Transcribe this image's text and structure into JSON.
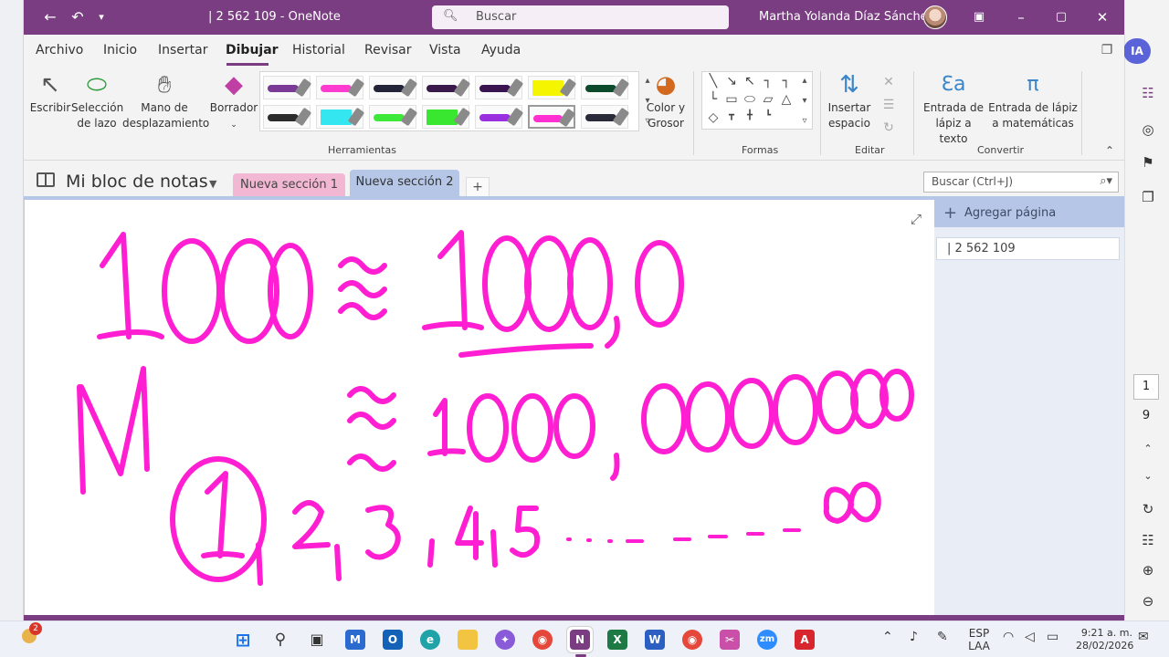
{
  "window": {
    "title": "| 2 562 109  -  OneNote",
    "search_placeholder": "Buscar",
    "user_name": "Martha Yolanda Díaz Sánchez"
  },
  "menu": {
    "items": [
      "Archivo",
      "Inicio",
      "Insertar",
      "Dibujar",
      "Historial",
      "Revisar",
      "Vista",
      "Ayuda"
    ],
    "active": "Dibujar"
  },
  "ribbon": {
    "escribir": "Escribir",
    "seleccion1": "Selección",
    "seleccion2": "de lazo",
    "mano1": "Mano de",
    "mano2": "desplazamiento",
    "borrador": "Borrador",
    "herramientas": "Herramientas",
    "color1": "Color y",
    "color2": "Grosor",
    "formas": "Formas",
    "insertar1": "Insertar",
    "insertar2": "espacio",
    "editar": "Editar",
    "entrada_texto1": "Entrada de",
    "entrada_texto2": "lápiz a texto",
    "entrada_mat1": "Entrada de lápiz",
    "entrada_mat2": "a matemáticas",
    "convertir": "Convertir",
    "pens": [
      {
        "color": "#7a3a96",
        "type": "pen"
      },
      {
        "color": "#ff3ccf",
        "type": "pen"
      },
      {
        "color": "#23233a",
        "type": "pen"
      },
      {
        "color": "#3a1a4a",
        "type": "pen"
      },
      {
        "color": "#3a1450",
        "type": "pen"
      },
      {
        "color": "#f5f500",
        "type": "highlighter"
      },
      {
        "color": "#0d4a2b",
        "type": "pen"
      },
      {
        "color": "#2b2b2b",
        "type": "pen"
      },
      {
        "color": "#33e6f0",
        "type": "highlighter"
      },
      {
        "color": "#3de838",
        "type": "pen"
      },
      {
        "color": "#39e630",
        "type": "highlighter"
      },
      {
        "color": "#9a2fe0",
        "type": "pen"
      },
      {
        "color": "#ff2fd2",
        "type": "pen"
      },
      {
        "color": "#2a2a3a",
        "type": "pen"
      }
    ],
    "selected_pen_index": 12
  },
  "notebook": {
    "name": "Mi bloc de notas",
    "sections": [
      "Nueva sección 1",
      "Nueva sección 2"
    ],
    "add_section": "+",
    "search_placeholder": "Buscar (Ctrl+J)"
  },
  "pages_pane": {
    "add_page": "Agregar página",
    "pages": [
      "| 2 562 109"
    ]
  },
  "zoom": {
    "box": "1",
    "value": "9"
  },
  "ink_color": "#ff1ed2",
  "taskbar": {
    "language1": "ESP",
    "language2": "LAA",
    "time": "9:21 a. m.",
    "date": "28/02/2026",
    "weather_badge": "2"
  },
  "ia_badge": "IA"
}
